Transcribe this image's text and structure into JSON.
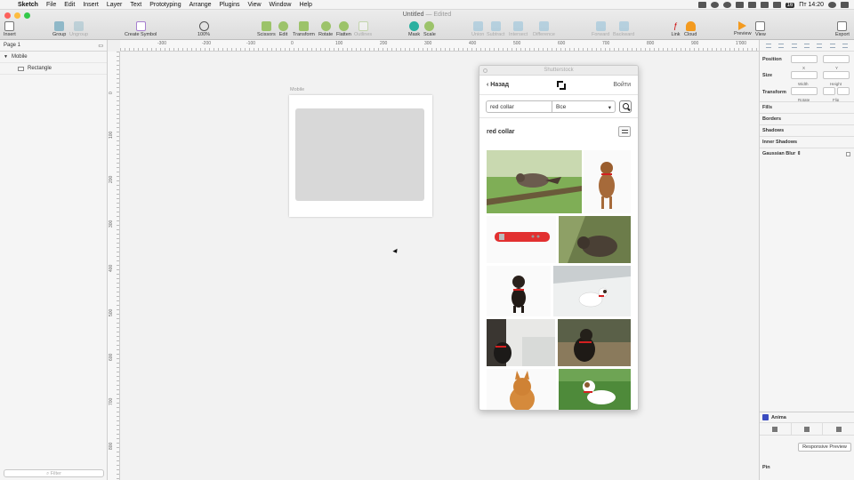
{
  "menubar": {
    "app_name": "Sketch",
    "items": [
      "File",
      "Edit",
      "Insert",
      "Layer",
      "Text",
      "Prototyping",
      "Arrange",
      "Plugins",
      "View",
      "Window",
      "Help"
    ],
    "status_badge": "16",
    "clock": "Пт 14:20"
  },
  "window": {
    "title": "Untitled",
    "edited": "— Edited"
  },
  "toolbar": {
    "insert": "Insert",
    "group": "Group",
    "ungroup": "Ungroup",
    "create_symbol": "Create Symbol",
    "zoom": "100%",
    "scissors": "Scissors",
    "edit": "Edit",
    "transform": "Transform",
    "rotate": "Rotate",
    "flatten": "Flatten",
    "outlines": "Outlines",
    "mask": "Mask",
    "scale": "Scale",
    "union": "Union",
    "subtract": "Subtract",
    "intersect": "Intersect",
    "difference": "Difference",
    "forward": "Forward",
    "backward": "Backward",
    "link": "Link",
    "cloud": "Cloud",
    "preview": "Preview",
    "view": "View",
    "export": "Export"
  },
  "ruler": {
    "h_ticks": [
      "-300",
      "-200",
      "-100",
      "0",
      "100",
      "200",
      "300",
      "400",
      "500",
      "600",
      "700",
      "800",
      "900",
      "1'000"
    ],
    "v_ticks": [
      "0",
      "100",
      "200",
      "300",
      "400",
      "500",
      "600",
      "700",
      "800"
    ]
  },
  "layers": {
    "page": "Page 1",
    "artboard": "Mobile",
    "child": "Rectangle",
    "filter_placeholder": "Filter"
  },
  "canvas": {
    "artboard_label": "Mobile"
  },
  "plugin": {
    "title": "Shutterstock",
    "back": "Назад",
    "login": "Войти",
    "query": "red collar",
    "category": "Все",
    "results_term": "red collar"
  },
  "inspector": {
    "position": "Position",
    "x": "X",
    "y": "Y",
    "size": "Size",
    "width": "Width",
    "height": "Height",
    "transform": "Transform",
    "rotate": "Rotate",
    "flip": "Flip",
    "fills": "Fills",
    "borders": "Borders",
    "shadows": "Shadows",
    "inner_shadows": "Inner Shadows",
    "gaussian_blur": "Gaussian Blur",
    "anima": "Anima",
    "responsive_preview": "Responsive Preview",
    "pin": "Pin"
  },
  "colors": {
    "close": "#fc605b",
    "minimize": "#fdbc40",
    "zoom": "#34c84a",
    "accent": "#3b4cc0"
  }
}
